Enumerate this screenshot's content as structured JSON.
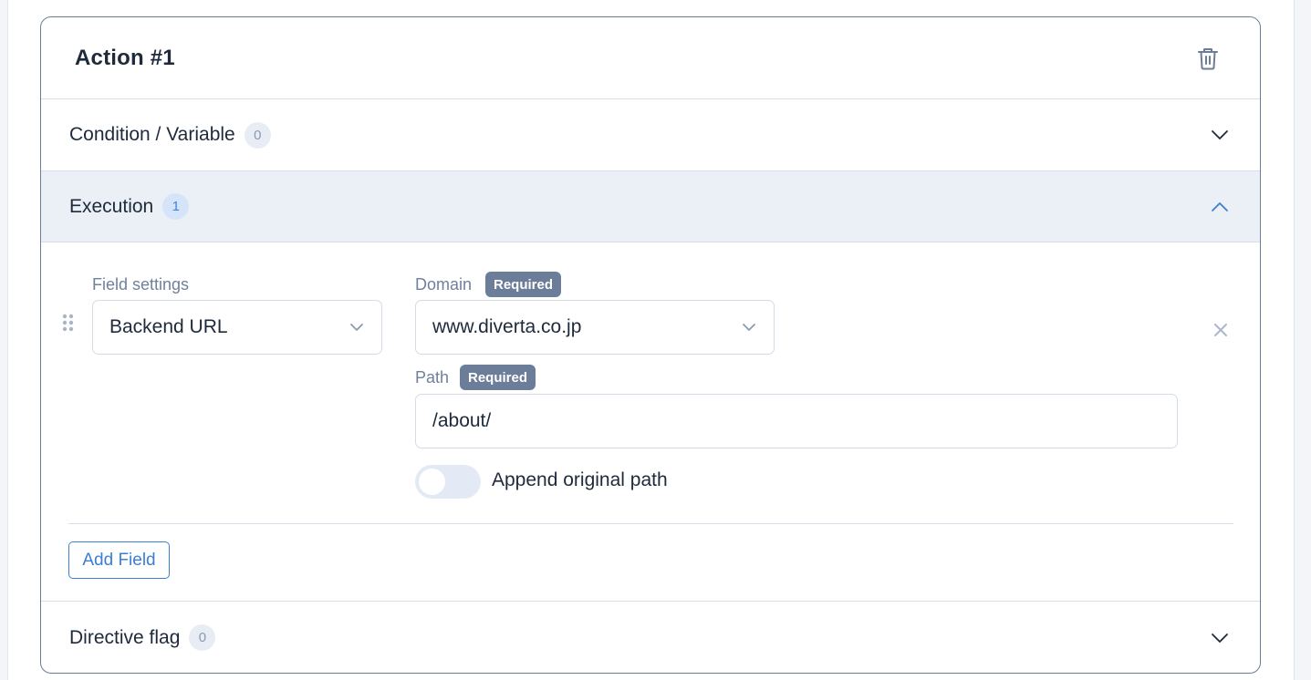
{
  "card": {
    "title": "Action #1",
    "delete_icon": "trash-icon"
  },
  "sections": {
    "condition": {
      "label": "Condition / Variable",
      "count": "0",
      "state": "collapsed",
      "icon": "chevron-down-icon"
    },
    "execution": {
      "label": "Execution",
      "count": "1",
      "state": "expanded",
      "icon": "chevron-up-icon"
    },
    "directive": {
      "label": "Directive flag",
      "count": "0",
      "state": "collapsed",
      "icon": "chevron-down-icon"
    }
  },
  "execution": {
    "field_settings": {
      "label": "Field settings",
      "value": "Backend URL"
    },
    "domain": {
      "label": "Domain",
      "required_badge": "Required",
      "value": "www.diverta.co.jp"
    },
    "path": {
      "label": "Path",
      "required_badge": "Required",
      "value": "/about/"
    },
    "append_original_path": {
      "label": "Append original path",
      "checked": false
    },
    "add_field_label": "Add Field"
  },
  "colors": {
    "accent": "#3a7fd4",
    "badge_bg": "#6b7d99",
    "section_open_bg": "#ebf0f7"
  }
}
